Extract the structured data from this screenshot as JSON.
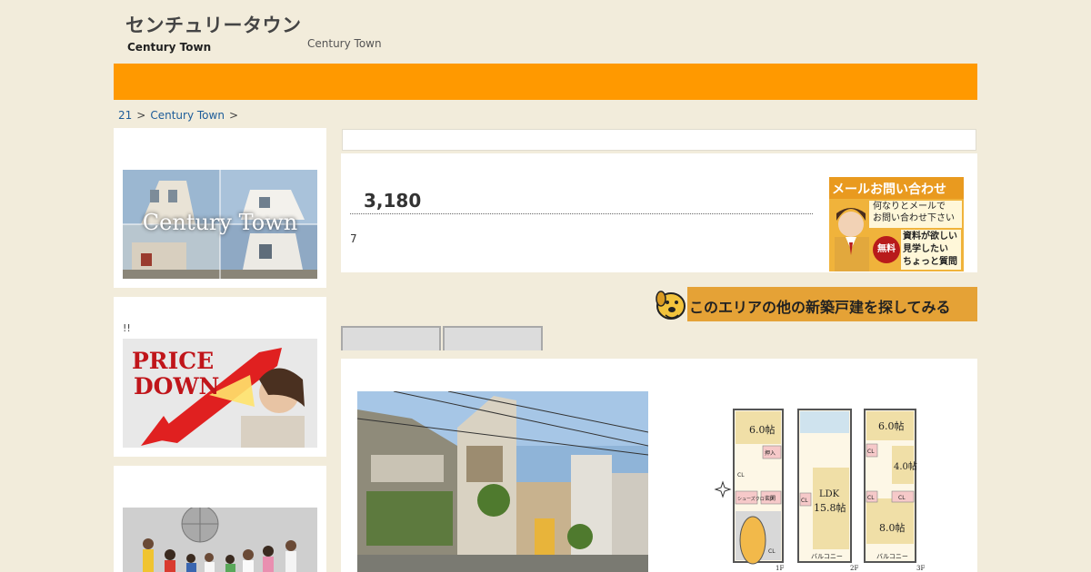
{
  "header": {
    "logo_jp": "センチュリータウン",
    "logo_en": "Century Town",
    "tagline": "Century Town"
  },
  "breadcrumb": {
    "items": [
      "21",
      "Century Town"
    ],
    "separator": ">"
  },
  "sidebar": {
    "banner1_text": "Century Town",
    "banner2_note": "!!",
    "banner2_text_line1": "PRICE",
    "banner2_text_line2": "DOWN"
  },
  "listing": {
    "price": "3,180",
    "sub_note": "7"
  },
  "contact_banner": {
    "title": "メールお問い合わせ",
    "line1": "何なりとメールで",
    "line2": "お問い合わせ下さい",
    "free": "無料",
    "line3": "資料が欲しい",
    "line4": "見学したい",
    "line5": "ちょっと質問"
  },
  "area_banner": {
    "label": "このエリアの他の新築戸建を探してみる"
  },
  "floorplan": {
    "rooms_1f": [
      "6.0帖",
      "押入",
      "CL",
      "シューズクローク",
      "玄関",
      "CL"
    ],
    "rooms_2f": [
      "LDK",
      "15.8帖",
      "CL",
      "バルコニー"
    ],
    "rooms_3f": [
      "6.0帖",
      "4.0帖",
      "8.0帖",
      "CL",
      "CL",
      "CL",
      "バルコニー"
    ],
    "floor_labels": [
      "1F",
      "2F",
      "3F"
    ]
  },
  "colors": {
    "background": "#f2ecdb",
    "nav": "#ff9900",
    "link": "#1d5c99",
    "banner_gold": "#e5a236"
  }
}
